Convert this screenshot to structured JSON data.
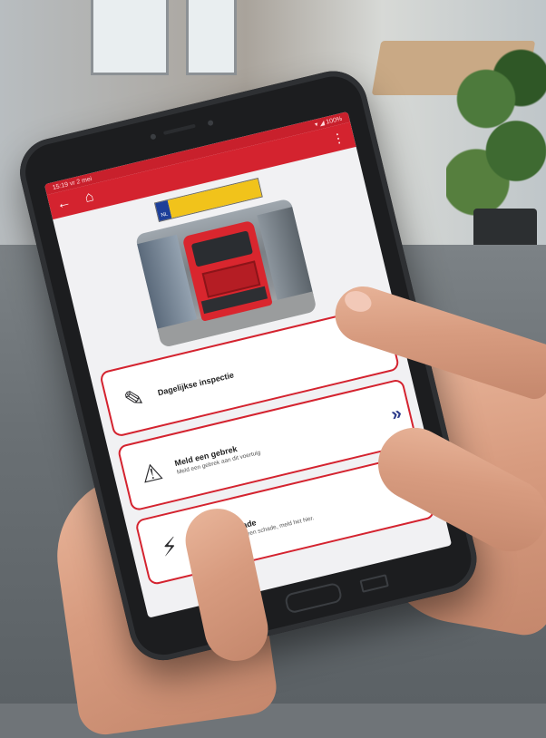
{
  "app": {
    "status_time": "15:19  vr 2 mei",
    "status_right": "▾ ◢ 100%",
    "back_icon": "←",
    "home_icon": "⌂",
    "menu_icon": "⋮",
    "plate_country": "NL"
  },
  "actions": [
    {
      "title": "Dagelijkse inspectie",
      "subtitle": "",
      "icon": "clipboard-edit-icon",
      "icon_glyph": "✎",
      "chevron": "»"
    },
    {
      "title": "Meld een gebrek",
      "subtitle": "Meld een gebrek aan dit voertuig",
      "icon": "warning-icon",
      "icon_glyph": "⚠",
      "chevron": "»"
    },
    {
      "title": "Meld een schade",
      "subtitle": "Ben je betrokken bij een schade, meld het hier.",
      "icon": "lightning-icon",
      "icon_glyph": "⚡",
      "chevron": "»"
    }
  ],
  "colors": {
    "brand_red": "#d4232f",
    "chevron_blue": "#2b3a8a",
    "plate_yellow": "#f1c31b"
  }
}
